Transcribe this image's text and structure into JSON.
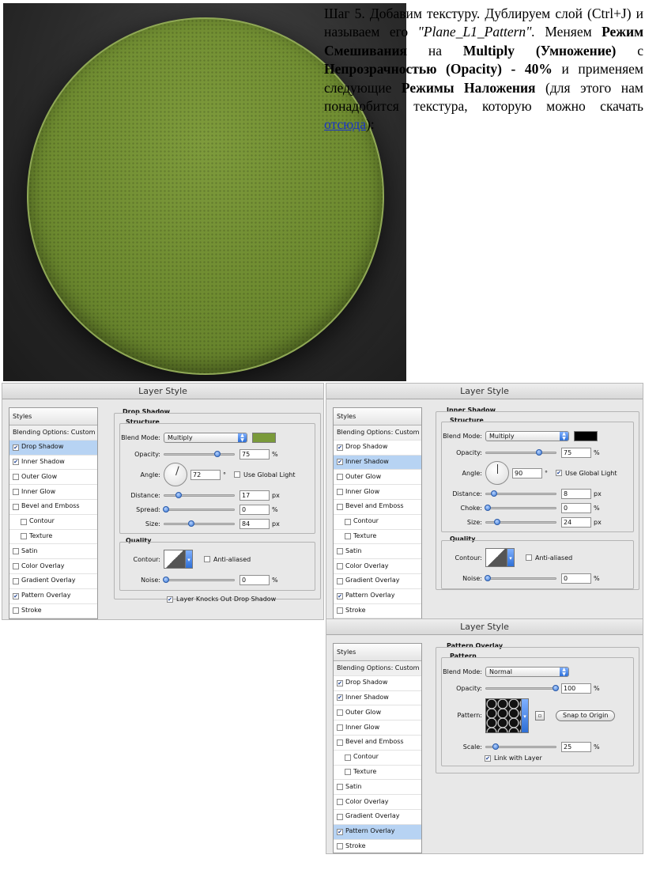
{
  "article": {
    "step_text": "Шаг 5.",
    "t1": " Добавим текстуру. Дублируем слой ",
    "layer_name": "(Ctrl+J)",
    "t2": " и называем его ",
    "new_name": "\"Plane_L1_Pattern\".",
    "t3": " Меняем ",
    "blend_label": "Режим Смешивания",
    "t4": " на ",
    "multiply": "Multiply (Умножение)",
    "t5": " с ",
    "opacity_label": "Непрозрачностью (Opacity) - 40%",
    "t6": " и применяем следующие ",
    "modes_label": "Режимы Наложения",
    "t7": " (для этого нам понадобится текстура, которую можно скачать ",
    "link_text": "отсюда",
    "t8": "):"
  },
  "styles_list": {
    "header": "Styles",
    "blending": "Blending Options: Custom",
    "items": [
      "Drop Shadow",
      "Inner Shadow",
      "Outer Glow",
      "Inner Glow",
      "Bevel and Emboss",
      "Contour",
      "Texture",
      "Satin",
      "Color Overlay",
      "Gradient Overlay",
      "Pattern Overlay",
      "Stroke"
    ],
    "checked": [
      true,
      true,
      false,
      false,
      false,
      false,
      false,
      false,
      false,
      false,
      true,
      false
    ]
  },
  "panel_title": "Layer Style",
  "drop_shadow": {
    "group": "Drop Shadow",
    "structure": "Structure",
    "blend_mode_label": "Blend Mode:",
    "blend_mode": "Multiply",
    "color": "#7a9a3a",
    "opacity_label": "Opacity:",
    "opacity": "75",
    "angle_label": "Angle:",
    "angle": "72",
    "global_light": "Use Global Light",
    "distance_label": "Distance:",
    "distance": "17",
    "spread_label": "Spread:",
    "spread": "0",
    "size_label": "Size:",
    "size": "84",
    "quality": "Quality",
    "contour_label": "Contour:",
    "anti_aliased": "Anti-aliased",
    "noise_label": "Noise:",
    "noise": "0",
    "knockout": "Layer Knocks Out Drop Shadow"
  },
  "inner_shadow": {
    "group": "Inner Shadow",
    "structure": "Structure",
    "blend_mode_label": "Blend Mode:",
    "blend_mode": "Multiply",
    "color": "#000000",
    "opacity_label": "Opacity:",
    "opacity": "75",
    "angle_label": "Angle:",
    "angle": "90",
    "global_light": "Use Global Light",
    "distance_label": "Distance:",
    "distance": "8",
    "choke_label": "Choke:",
    "choke": "0",
    "size_label": "Size:",
    "size": "24",
    "quality": "Quality",
    "contour_label": "Contour:",
    "anti_aliased": "Anti-aliased",
    "noise_label": "Noise:",
    "noise": "0"
  },
  "pattern_overlay": {
    "group": "Pattern Overlay",
    "pattern_sub": "Pattern",
    "blend_mode_label": "Blend Mode:",
    "blend_mode": "Normal",
    "opacity_label": "Opacity:",
    "opacity": "100",
    "pattern_label": "Pattern:",
    "snap": "Snap to Origin",
    "scale_label": "Scale:",
    "scale": "25",
    "link": "Link with Layer"
  },
  "units": {
    "pct": "%",
    "px": "px",
    "deg": "°"
  },
  "colors": {
    "disc": "#6e8b30",
    "link": "#1a33c8",
    "selected": "#b7d3f3"
  },
  "icons": {
    "check": "✔",
    "arrow": "▲▼"
  }
}
